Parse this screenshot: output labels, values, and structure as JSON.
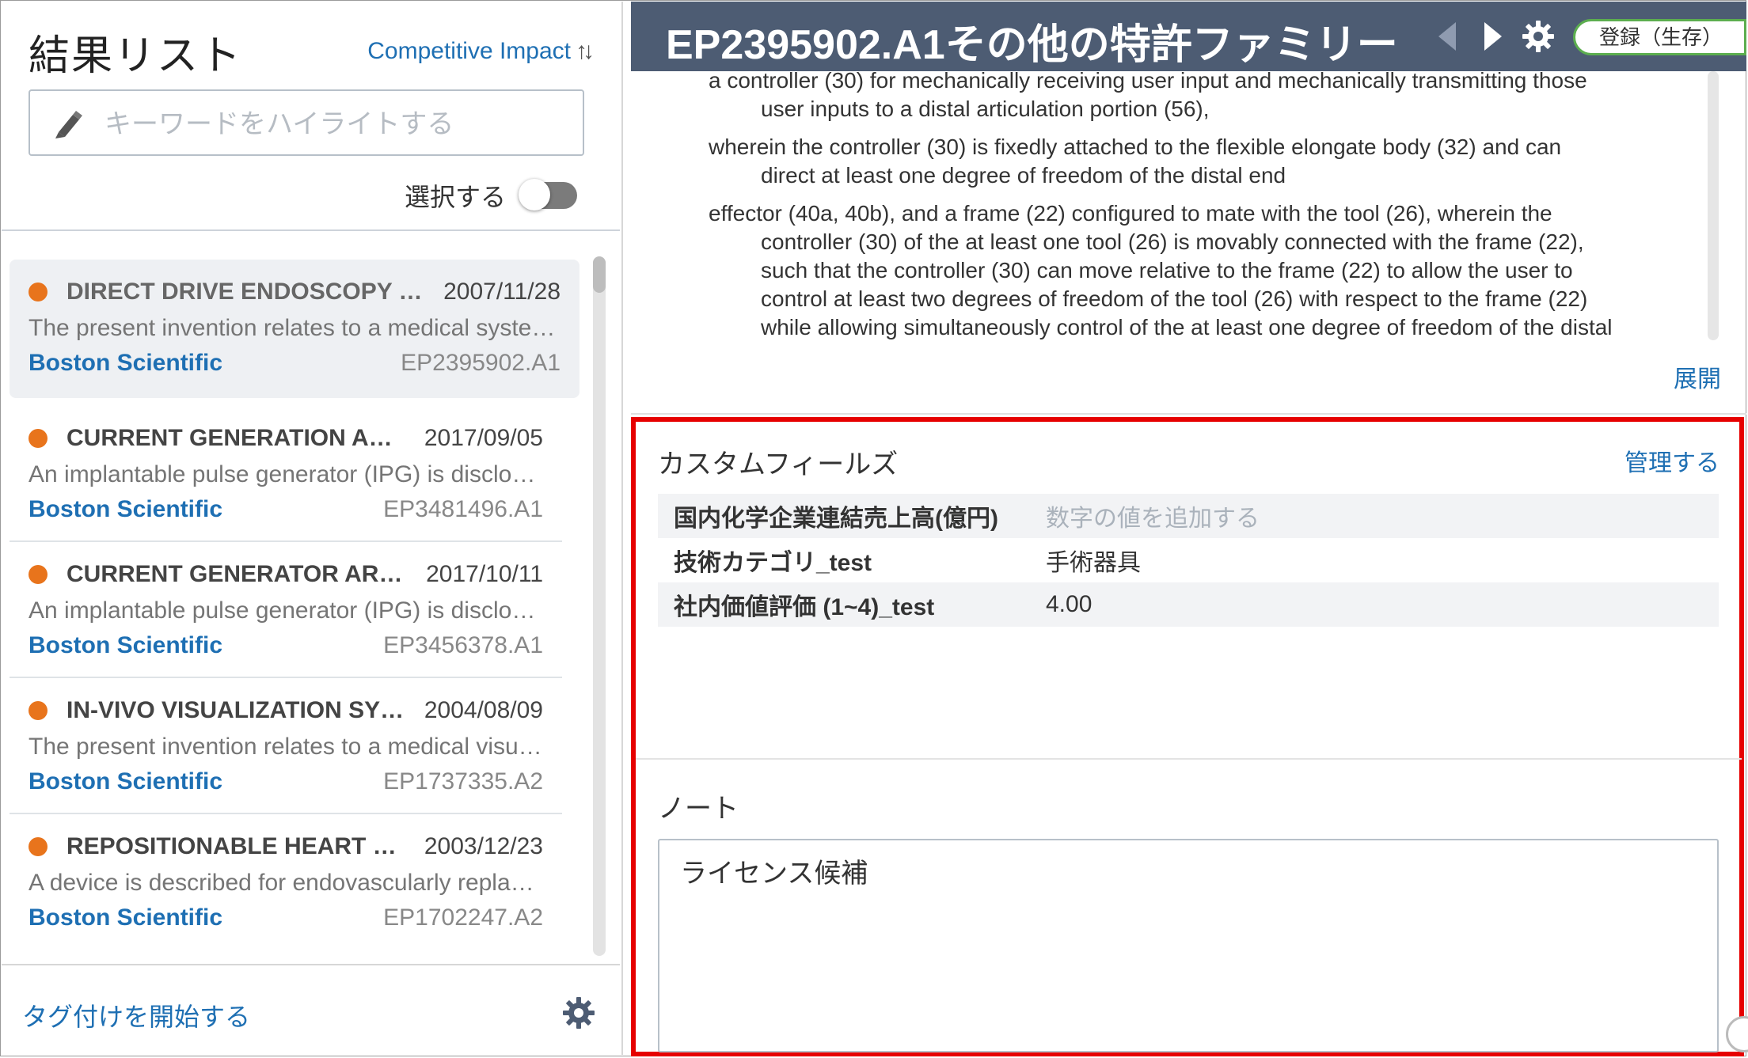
{
  "left_panel": {
    "title": "結果リスト",
    "sort_label": "Competitive Impact",
    "sort_arrows": "↑↓",
    "search_placeholder": "キーワードをハイライトする",
    "select_label": "選択する",
    "results": [
      {
        "title": "DIRECT DRIVE ENDOSCOPY SYSTEMS AND METHODS",
        "date": "2007/11/28",
        "abstract": "The present invention relates to a medical system for performing endoscopic procedures",
        "company": "Boston Scientific",
        "pub": "EP2395902.A1"
      },
      {
        "title": "CURRENT GENERATION ARCHITECTURE FOR AN IMPLANTABLE STIMULATOR",
        "date": "2017/09/05",
        "abstract": "An implantable pulse generator (IPG) is disclosed having current generation architecture",
        "company": "Boston Scientific",
        "pub": "EP3481496.A1"
      },
      {
        "title": "CURRENT GENERATOR ARCHITECTURE FOR AN IMPLANTABLE STIMULATOR",
        "date": "2017/10/11",
        "abstract": "An implantable pulse generator (IPG) is disclosed having current generator architecture",
        "company": "Boston Scientific",
        "pub": "EP3456378.A1"
      },
      {
        "title": "IN-VIVO VISUALIZATION SYSTEM",
        "date": "2004/08/09",
        "abstract": "The present invention relates to a medical visualization system",
        "company": "Boston Scientific",
        "pub": "EP1737335.A2"
      },
      {
        "title": "REPOSITIONABLE HEART VALVE",
        "date": "2003/12/23",
        "abstract": "A device is described for endovascularly replacing a patient's heart valve",
        "company": "Boston Scientific",
        "pub": "EP1702247.A2"
      }
    ],
    "footer_tag_label": "タグ付けを開始する"
  },
  "header": {
    "title": "EP2395902.A1その他の特許ファミリー",
    "status_label": "登録（生存）"
  },
  "claims": [
    {
      "first": "a controller (30) for mechanically receiving user input and mechanically transmitting those",
      "rest": "user inputs to a distal articulation portion (56),"
    },
    {
      "first": "wherein the controller (30) is fixedly attached to the flexible elongate body (32) and can",
      "rest": "direct at least one degree of freedom of the distal end"
    },
    {
      "first": "effector (40a, 40b), and a frame (22) configured to mate with the tool (26), wherein the",
      "rest": "controller (30) of the at least one tool (26) is movably connected with the frame (22), such that the controller (30) can move relative to the frame (22) to allow the user to control at least two degrees of freedom of the tool (26) with respect to the frame (22) while allowing simultaneously control of the at least one degree of freedom of the distal"
    }
  ],
  "expand_label": "展開",
  "custom_fields": {
    "title": "カスタムフィールズ",
    "manage_label": "管理する",
    "rows": [
      {
        "label": "国内化学企業連結売上高(億円)",
        "value": "数字の値を追加する"
      },
      {
        "label": "技術カテゴリ_test",
        "value": "手術器具"
      },
      {
        "label": "社内価値評価 (1~4)_test",
        "value": "4.00"
      }
    ]
  },
  "note": {
    "title": "ノート",
    "value": "ライセンス候補"
  },
  "colors": {
    "header_bg": "#4d5c73",
    "accent_link": "#1e6fb3",
    "status_dot": "#e8741c",
    "highlight_border": "#e60000",
    "status_pill_border": "#5cae4f"
  },
  "icons": {
    "search": "highlighter-pen-icon",
    "settings": "gear-icon",
    "prev": "chevron-left-icon",
    "next": "chevron-right-icon"
  }
}
